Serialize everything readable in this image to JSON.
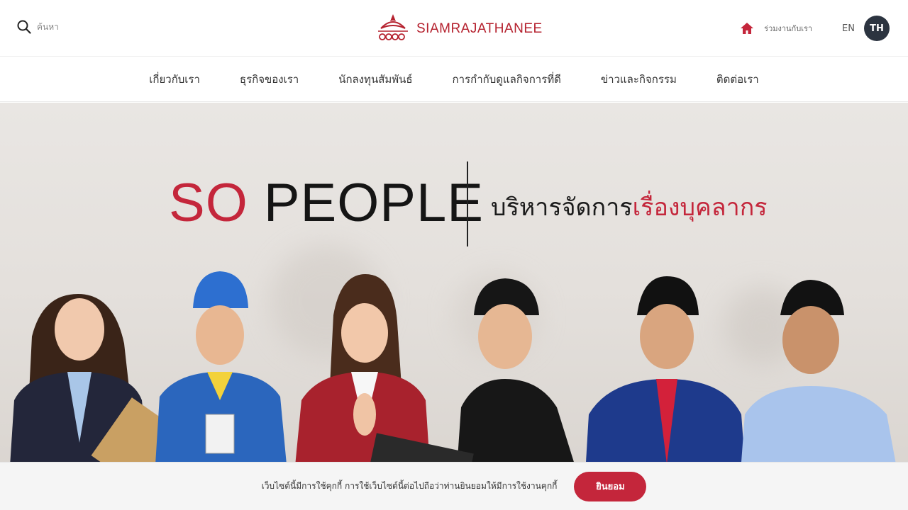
{
  "header": {
    "search_placeholder": "ค้นหา",
    "logo_text": "SIAMRAJATHANEE",
    "join_label": "ร่วมงานกับเรา",
    "lang_en": "EN",
    "lang_th": "TH"
  },
  "nav": {
    "items": [
      {
        "label": "เกี่ยวกับเรา"
      },
      {
        "label": "ธุรกิจของเรา"
      },
      {
        "label": "นักลงทุนสัมพันธ์"
      },
      {
        "label": "การกำกับดูแลกิจการที่ดี"
      },
      {
        "label": "ข่าวและกิจกรรม"
      },
      {
        "label": "ติดต่อเรา"
      }
    ]
  },
  "hero": {
    "title_so": "SO",
    "title_people": "PEOPLE",
    "subtitle_main": "บริหารจัดการ",
    "subtitle_accent": "เรื่องบุคลากร"
  },
  "cookie": {
    "text": "เว็บไซต์นี้มีการใช้คุกกี้ การใช้เว็บไซต์นี้ต่อไปถือว่าท่านยินยอมให้มีการใช้งานคุกกี้",
    "accept_label": "ยินยอม"
  },
  "colors": {
    "brand_red": "#c4263b",
    "dark_badge": "#2c3440"
  }
}
